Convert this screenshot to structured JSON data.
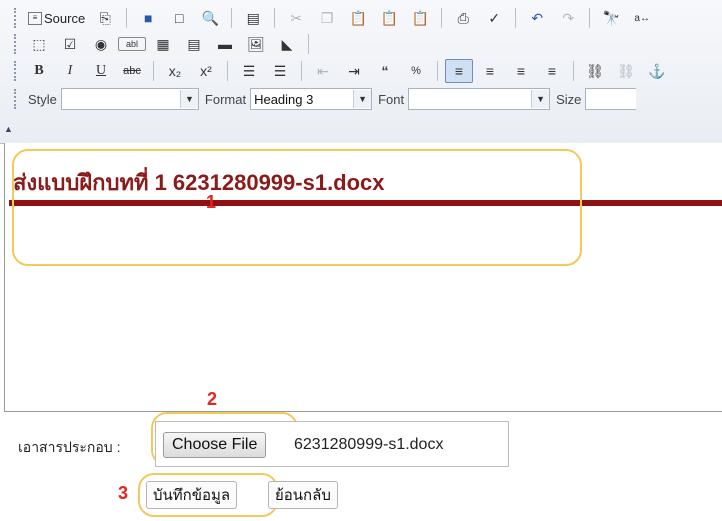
{
  "toolbar": {
    "source_label": "Source",
    "style_label": "Style",
    "style_value": "",
    "format_label": "Format",
    "format_value": "Heading 3",
    "font_label": "Font",
    "font_value": "",
    "size_label": "Size",
    "size_value": ""
  },
  "editor": {
    "heading": "ส่งแบบฝึกบทที่ 1  6231280999-s1.docx"
  },
  "form": {
    "attachment_label": "เอาสารประกอบ :",
    "choose_file_label": "Choose File",
    "file_name": "6231280999-s1.docx",
    "save_label": "บันทึกข้อมูล",
    "back_label": "ย้อนกลับ"
  },
  "annotations": {
    "one": "1",
    "two": "2",
    "three": "3",
    "color": "#e3261c",
    "outline_color": "#f3c95a"
  },
  "colors": {
    "heading": "#8b1a1a",
    "rule": "#8f1111"
  }
}
